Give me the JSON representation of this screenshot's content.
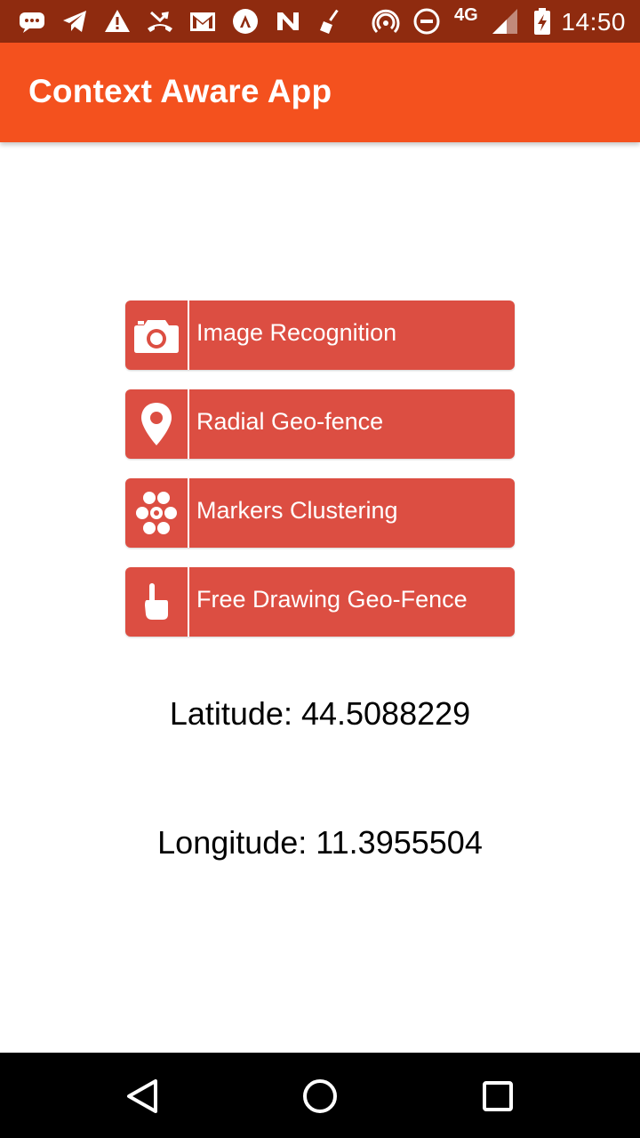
{
  "status_bar": {
    "network_label": "4G",
    "time": "14:50",
    "icons": [
      "chat-icon",
      "telegram-icon",
      "warning-icon",
      "missed-call-icon",
      "gmail-icon",
      "app-a-icon",
      "app-n-icon",
      "broom-icon",
      "hotspot-icon",
      "do-not-disturb-icon",
      "signal-icon",
      "battery-charging-icon"
    ],
    "background": "#8f2b0f"
  },
  "app_bar": {
    "title": "Context Aware App",
    "background": "#f4511e"
  },
  "buttons": [
    {
      "label": "Image Recognition",
      "icon": "camera-icon"
    },
    {
      "label": "Radial Geo-fence",
      "icon": "map-pin-icon"
    },
    {
      "label": "Markers Clustering",
      "icon": "hexagon-cluster-icon"
    },
    {
      "label": "Free Drawing Geo-Fence",
      "icon": "pointing-hand-icon"
    }
  ],
  "button_color": "#dc4e42",
  "location": {
    "latitude": "Latitude: 44.5088229",
    "longitude": "Longitude: 11.3955504"
  },
  "nav_bar": {
    "buttons": [
      "back-icon",
      "home-icon",
      "recents-icon"
    ]
  }
}
